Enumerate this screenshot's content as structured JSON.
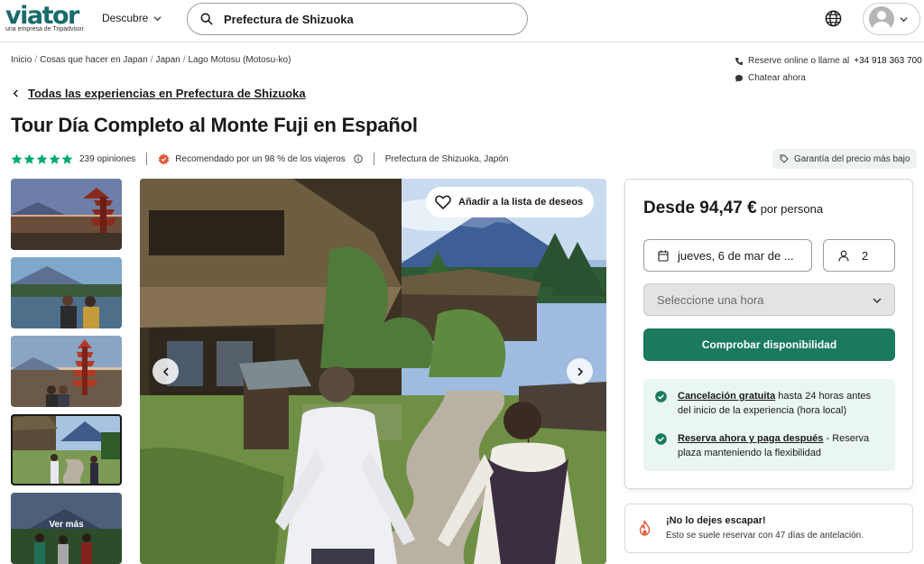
{
  "header": {
    "logo_text": "viator",
    "logo_subtext": "una empresa de Tripadvisor",
    "discover_label": "Descubre",
    "search_value": "Prefectura de Shizuoka"
  },
  "breadcrumb": [
    "Inicio",
    "Cosas que hacer en Japan",
    "Japan",
    "Lago Motosu (Motosu-ko)"
  ],
  "contact": {
    "reserve_text": "Reserve online o llame al",
    "phone": "+34 918 363 700",
    "chat_label": "Chatear ahora"
  },
  "back_link": "Todas las experiencias en Prefectura de Shizuoka",
  "title": "Tour Día Completo al Monte Fuji en Español",
  "meta": {
    "rating": 5,
    "reviews": "239 opiniones",
    "recommended": "Recomendado por un 98 % de los viajeros",
    "location": "Prefectura de Shizuoka, Japón",
    "guarantee": "Garantía del precio más bajo"
  },
  "gallery": {
    "more_label": "Ver más",
    "wishlist_label": "Añadir a la lista de deseos"
  },
  "booking": {
    "price_from": "Desde 94,47 €",
    "price_unit": "por persona",
    "date": "jueves, 6 de mar de ...",
    "travelers": "2",
    "time_placeholder": "Seleccione una hora",
    "cta": "Comprobar disponibilidad",
    "perk1_link": "Cancelación gratuita",
    "perk1_rest": " hasta 24 horas antes del inicio de la experiencia (hora local)",
    "perk2_link": "Reserva ahora y paga después",
    "perk2_rest": " - Reserva plaza manteniendo la flexibilidad"
  },
  "urgency": {
    "title": "¡No lo dejes escapar!",
    "subtitle": "Esto se suele reservar con 47 días de antelación."
  },
  "colors": {
    "brand": "#186b6d",
    "cta": "#1b7a5e",
    "stars": "#00aa6c",
    "perks_bg": "#eaf6f1"
  }
}
